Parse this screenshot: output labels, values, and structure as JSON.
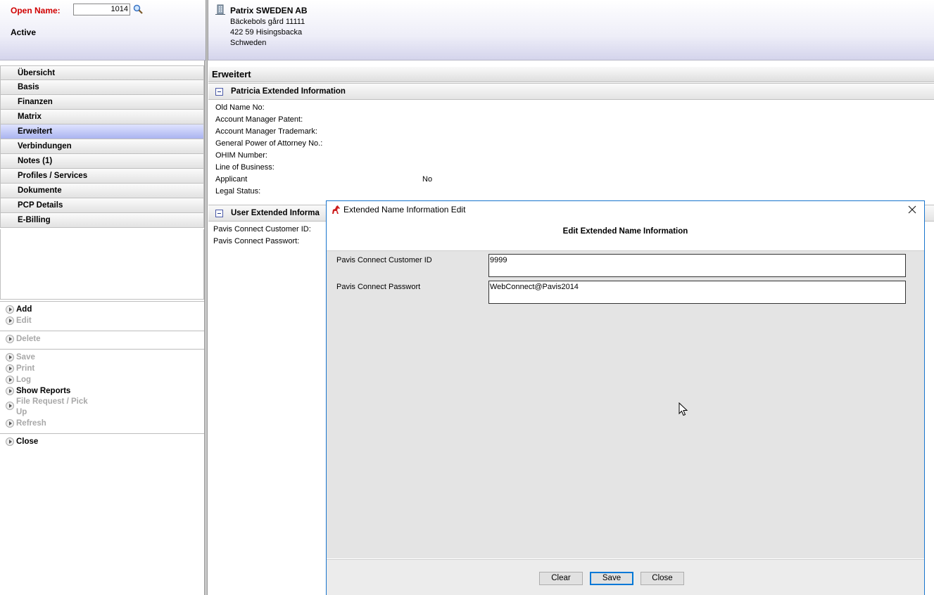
{
  "header": {
    "open_name_label": "Open Name:",
    "open_name_value": "1014",
    "status": "Active",
    "company_name": "Patrix SWEDEN AB",
    "address_lines": [
      "Bäckebols gård 11111",
      "422 59 Hisingsbacka",
      "Schweden"
    ]
  },
  "nav": {
    "items": [
      {
        "label": "Übersicht"
      },
      {
        "label": "Basis"
      },
      {
        "label": "Finanzen"
      },
      {
        "label": "Matrix"
      },
      {
        "label": "Erweitert"
      },
      {
        "label": "Verbindungen"
      },
      {
        "label": "Notes (1)"
      },
      {
        "label": "Profiles / Services"
      },
      {
        "label": "Dokumente"
      },
      {
        "label": "PCP Details"
      },
      {
        "label": "E-Billing"
      }
    ]
  },
  "actions": {
    "add": "Add",
    "edit": "Edit",
    "delete": "Delete",
    "save": "Save",
    "print": "Print",
    "log": "Log",
    "show_reports": "Show Reports",
    "file_request_1": "File Request / Pick",
    "file_request_2": "Up",
    "refresh": "Refresh",
    "close": "Close"
  },
  "main": {
    "title": "Erweitert",
    "section1": {
      "title": "Patricia Extended Information",
      "fields": [
        "Old Name No:",
        "Account Manager Patent:",
        "Account Manager Trademark:",
        "General Power of Attorney No.:",
        "OHIM Number:",
        "Line of Business:",
        "Applicant",
        "Legal Status:"
      ],
      "applicant_value": "No"
    },
    "section2": {
      "title": "User Extended Informa",
      "fields": [
        "Pavis Connect Customer ID:",
        "Pavis Connect Passwort:"
      ]
    }
  },
  "dialog": {
    "window_title": "Extended Name Information Edit",
    "heading": "Edit Extended Name Information",
    "customer_id_label": "Pavis Connect Customer ID",
    "customer_id_value": "9999",
    "password_label": "Pavis Connect Passwort",
    "password_value": "WebConnect@Pavis2014",
    "clear_button": "Clear",
    "save_button": "Save",
    "close_button": "Close"
  }
}
